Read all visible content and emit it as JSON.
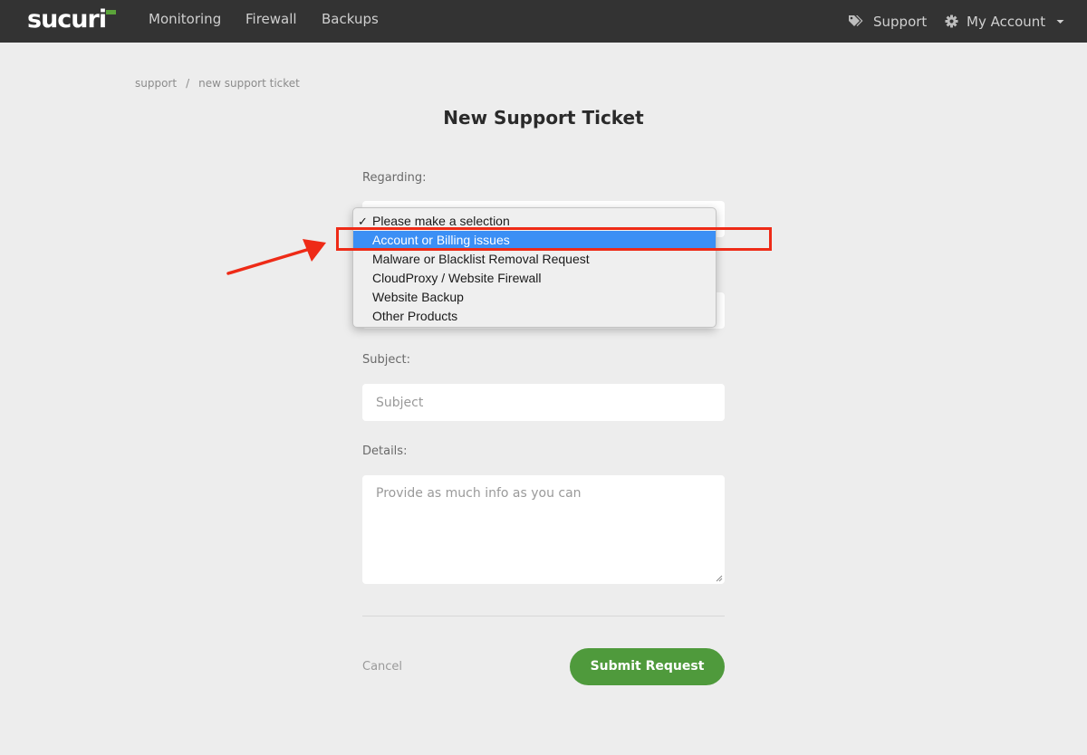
{
  "app": {
    "logo_text": "sucuri"
  },
  "nav": {
    "monitoring": "Monitoring",
    "firewall": "Firewall",
    "backups": "Backups",
    "support": "Support",
    "my_account": "My Account"
  },
  "breadcrumb": {
    "root": "support",
    "separator": "/",
    "current": "new support ticket"
  },
  "page": {
    "title": "New Support Ticket"
  },
  "form": {
    "regarding_label": "Regarding:",
    "regarding_options": [
      {
        "label": "Please make a selection",
        "checked": true
      },
      {
        "label": "Account or Billing issues",
        "highlighted": true
      },
      {
        "label": "Malware or Blacklist Removal Request"
      },
      {
        "label": "CloudProxy / Website Firewall"
      },
      {
        "label": "Website Backup"
      },
      {
        "label": "Other Products"
      }
    ],
    "check_mark": "✓",
    "subject_label": "Subject:",
    "subject_placeholder": "Subject",
    "details_label": "Details:",
    "details_placeholder": "Provide as much info as you can",
    "cancel_label": "Cancel",
    "submit_label": "Submit Request"
  },
  "colors": {
    "topbar": "#333333",
    "logo_accent": "#5ba43a",
    "submit": "#4f9a3c",
    "selected_option": "#3b8ff5",
    "annotation": "#ee2b17"
  }
}
